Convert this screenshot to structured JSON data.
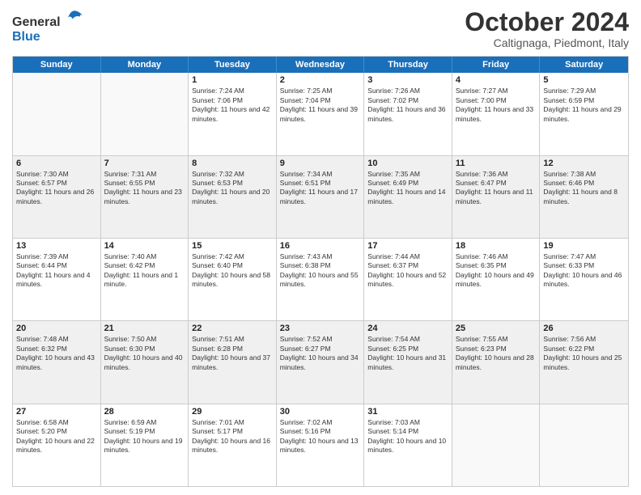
{
  "logo": {
    "text_general": "General",
    "text_blue": "Blue"
  },
  "title": "October 2024",
  "location": "Caltignaga, Piedmont, Italy",
  "days_of_week": [
    "Sunday",
    "Monday",
    "Tuesday",
    "Wednesday",
    "Thursday",
    "Friday",
    "Saturday"
  ],
  "weeks": [
    [
      {
        "day": "",
        "sunrise": "",
        "sunset": "",
        "daylight": "",
        "shaded": false,
        "empty": true
      },
      {
        "day": "",
        "sunrise": "",
        "sunset": "",
        "daylight": "",
        "shaded": false,
        "empty": true
      },
      {
        "day": "1",
        "sunrise": "Sunrise: 7:24 AM",
        "sunset": "Sunset: 7:06 PM",
        "daylight": "Daylight: 11 hours and 42 minutes.",
        "shaded": false,
        "empty": false
      },
      {
        "day": "2",
        "sunrise": "Sunrise: 7:25 AM",
        "sunset": "Sunset: 7:04 PM",
        "daylight": "Daylight: 11 hours and 39 minutes.",
        "shaded": false,
        "empty": false
      },
      {
        "day": "3",
        "sunrise": "Sunrise: 7:26 AM",
        "sunset": "Sunset: 7:02 PM",
        "daylight": "Daylight: 11 hours and 36 minutes.",
        "shaded": false,
        "empty": false
      },
      {
        "day": "4",
        "sunrise": "Sunrise: 7:27 AM",
        "sunset": "Sunset: 7:00 PM",
        "daylight": "Daylight: 11 hours and 33 minutes.",
        "shaded": false,
        "empty": false
      },
      {
        "day": "5",
        "sunrise": "Sunrise: 7:29 AM",
        "sunset": "Sunset: 6:59 PM",
        "daylight": "Daylight: 11 hours and 29 minutes.",
        "shaded": false,
        "empty": false
      }
    ],
    [
      {
        "day": "6",
        "sunrise": "Sunrise: 7:30 AM",
        "sunset": "Sunset: 6:57 PM",
        "daylight": "Daylight: 11 hours and 26 minutes.",
        "shaded": true,
        "empty": false
      },
      {
        "day": "7",
        "sunrise": "Sunrise: 7:31 AM",
        "sunset": "Sunset: 6:55 PM",
        "daylight": "Daylight: 11 hours and 23 minutes.",
        "shaded": true,
        "empty": false
      },
      {
        "day": "8",
        "sunrise": "Sunrise: 7:32 AM",
        "sunset": "Sunset: 6:53 PM",
        "daylight": "Daylight: 11 hours and 20 minutes.",
        "shaded": true,
        "empty": false
      },
      {
        "day": "9",
        "sunrise": "Sunrise: 7:34 AM",
        "sunset": "Sunset: 6:51 PM",
        "daylight": "Daylight: 11 hours and 17 minutes.",
        "shaded": true,
        "empty": false
      },
      {
        "day": "10",
        "sunrise": "Sunrise: 7:35 AM",
        "sunset": "Sunset: 6:49 PM",
        "daylight": "Daylight: 11 hours and 14 minutes.",
        "shaded": true,
        "empty": false
      },
      {
        "day": "11",
        "sunrise": "Sunrise: 7:36 AM",
        "sunset": "Sunset: 6:47 PM",
        "daylight": "Daylight: 11 hours and 11 minutes.",
        "shaded": true,
        "empty": false
      },
      {
        "day": "12",
        "sunrise": "Sunrise: 7:38 AM",
        "sunset": "Sunset: 6:46 PM",
        "daylight": "Daylight: 11 hours and 8 minutes.",
        "shaded": true,
        "empty": false
      }
    ],
    [
      {
        "day": "13",
        "sunrise": "Sunrise: 7:39 AM",
        "sunset": "Sunset: 6:44 PM",
        "daylight": "Daylight: 11 hours and 4 minutes.",
        "shaded": false,
        "empty": false
      },
      {
        "day": "14",
        "sunrise": "Sunrise: 7:40 AM",
        "sunset": "Sunset: 6:42 PM",
        "daylight": "Daylight: 11 hours and 1 minute.",
        "shaded": false,
        "empty": false
      },
      {
        "day": "15",
        "sunrise": "Sunrise: 7:42 AM",
        "sunset": "Sunset: 6:40 PM",
        "daylight": "Daylight: 10 hours and 58 minutes.",
        "shaded": false,
        "empty": false
      },
      {
        "day": "16",
        "sunrise": "Sunrise: 7:43 AM",
        "sunset": "Sunset: 6:38 PM",
        "daylight": "Daylight: 10 hours and 55 minutes.",
        "shaded": false,
        "empty": false
      },
      {
        "day": "17",
        "sunrise": "Sunrise: 7:44 AM",
        "sunset": "Sunset: 6:37 PM",
        "daylight": "Daylight: 10 hours and 52 minutes.",
        "shaded": false,
        "empty": false
      },
      {
        "day": "18",
        "sunrise": "Sunrise: 7:46 AM",
        "sunset": "Sunset: 6:35 PM",
        "daylight": "Daylight: 10 hours and 49 minutes.",
        "shaded": false,
        "empty": false
      },
      {
        "day": "19",
        "sunrise": "Sunrise: 7:47 AM",
        "sunset": "Sunset: 6:33 PM",
        "daylight": "Daylight: 10 hours and 46 minutes.",
        "shaded": false,
        "empty": false
      }
    ],
    [
      {
        "day": "20",
        "sunrise": "Sunrise: 7:48 AM",
        "sunset": "Sunset: 6:32 PM",
        "daylight": "Daylight: 10 hours and 43 minutes.",
        "shaded": true,
        "empty": false
      },
      {
        "day": "21",
        "sunrise": "Sunrise: 7:50 AM",
        "sunset": "Sunset: 6:30 PM",
        "daylight": "Daylight: 10 hours and 40 minutes.",
        "shaded": true,
        "empty": false
      },
      {
        "day": "22",
        "sunrise": "Sunrise: 7:51 AM",
        "sunset": "Sunset: 6:28 PM",
        "daylight": "Daylight: 10 hours and 37 minutes.",
        "shaded": true,
        "empty": false
      },
      {
        "day": "23",
        "sunrise": "Sunrise: 7:52 AM",
        "sunset": "Sunset: 6:27 PM",
        "daylight": "Daylight: 10 hours and 34 minutes.",
        "shaded": true,
        "empty": false
      },
      {
        "day": "24",
        "sunrise": "Sunrise: 7:54 AM",
        "sunset": "Sunset: 6:25 PM",
        "daylight": "Daylight: 10 hours and 31 minutes.",
        "shaded": true,
        "empty": false
      },
      {
        "day": "25",
        "sunrise": "Sunrise: 7:55 AM",
        "sunset": "Sunset: 6:23 PM",
        "daylight": "Daylight: 10 hours and 28 minutes.",
        "shaded": true,
        "empty": false
      },
      {
        "day": "26",
        "sunrise": "Sunrise: 7:56 AM",
        "sunset": "Sunset: 6:22 PM",
        "daylight": "Daylight: 10 hours and 25 minutes.",
        "shaded": true,
        "empty": false
      }
    ],
    [
      {
        "day": "27",
        "sunrise": "Sunrise: 6:58 AM",
        "sunset": "Sunset: 5:20 PM",
        "daylight": "Daylight: 10 hours and 22 minutes.",
        "shaded": false,
        "empty": false
      },
      {
        "day": "28",
        "sunrise": "Sunrise: 6:59 AM",
        "sunset": "Sunset: 5:19 PM",
        "daylight": "Daylight: 10 hours and 19 minutes.",
        "shaded": false,
        "empty": false
      },
      {
        "day": "29",
        "sunrise": "Sunrise: 7:01 AM",
        "sunset": "Sunset: 5:17 PM",
        "daylight": "Daylight: 10 hours and 16 minutes.",
        "shaded": false,
        "empty": false
      },
      {
        "day": "30",
        "sunrise": "Sunrise: 7:02 AM",
        "sunset": "Sunset: 5:16 PM",
        "daylight": "Daylight: 10 hours and 13 minutes.",
        "shaded": false,
        "empty": false
      },
      {
        "day": "31",
        "sunrise": "Sunrise: 7:03 AM",
        "sunset": "Sunset: 5:14 PM",
        "daylight": "Daylight: 10 hours and 10 minutes.",
        "shaded": false,
        "empty": false
      },
      {
        "day": "",
        "sunrise": "",
        "sunset": "",
        "daylight": "",
        "shaded": false,
        "empty": true
      },
      {
        "day": "",
        "sunrise": "",
        "sunset": "",
        "daylight": "",
        "shaded": false,
        "empty": true
      }
    ]
  ]
}
